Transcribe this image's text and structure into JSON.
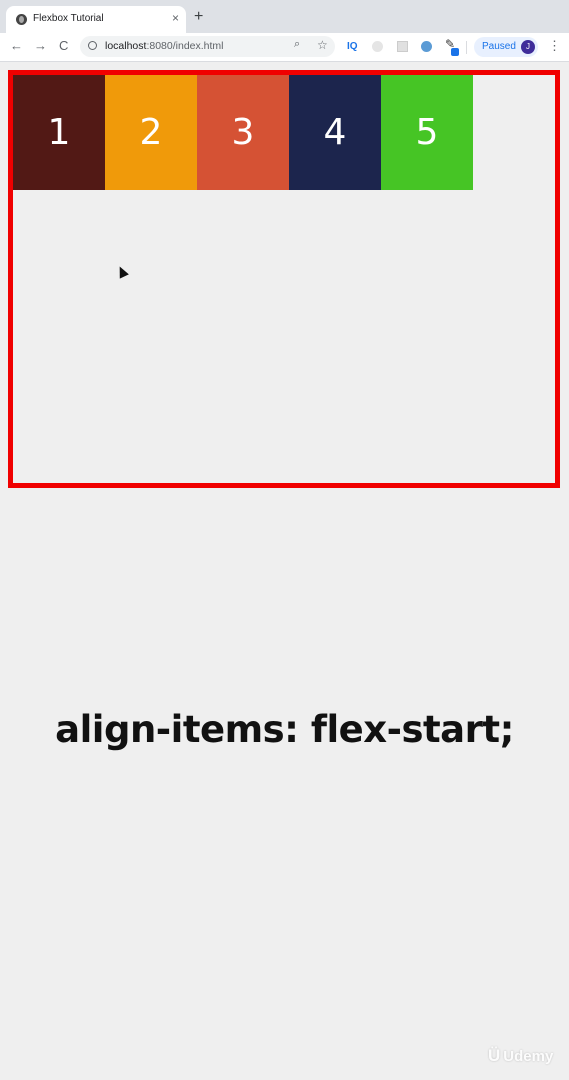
{
  "browser": {
    "tab_title": "Flexbox Tutorial",
    "tab_close": "×",
    "new_tab": "+",
    "back": "←",
    "forward": "→",
    "reload": "C",
    "url_host": "localhost",
    "url_rest": ":8080/index.html",
    "zoom_icon": "⌕",
    "star_icon": "☆",
    "ext_iq": "IQ",
    "pen_icon": "✎",
    "profile_status": "Paused",
    "avatar_initial": "J",
    "menu_icon": "⋮"
  },
  "flex_items": [
    {
      "label": "1",
      "color": "#521915"
    },
    {
      "label": "2",
      "color": "#f09a0a"
    },
    {
      "label": "3",
      "color": "#d55234"
    },
    {
      "label": "4",
      "color": "#1c254d"
    },
    {
      "label": "5",
      "color": "#46c525"
    }
  ],
  "caption": "align-items: flex-start;",
  "watermark": {
    "logo": "Ü",
    "text": "Udemy"
  },
  "colors": {
    "container_border": "#f00000",
    "page_background": "#efefef"
  }
}
